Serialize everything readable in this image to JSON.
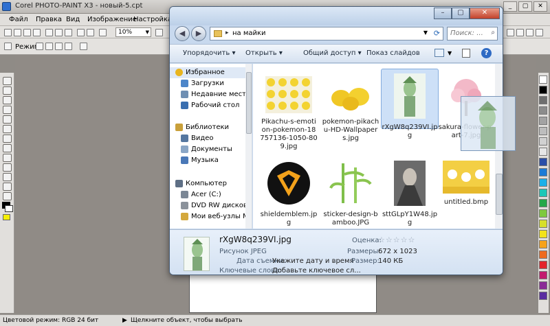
{
  "app": {
    "title": "Corel PHOTO-PAINT X3 - новый-5.cpt",
    "menu": [
      "Файл",
      "Правка",
      "Вид",
      "Изображение",
      "Настройка"
    ],
    "zoom": "10%",
    "mode_label": "Режим",
    "status_mode": "Цветовой режим: RGB 24 бит",
    "status_hint": "Щелкните объект, чтобы выбрать"
  },
  "explorer": {
    "address": "на майки",
    "search_placeholder": "Поиск: ...",
    "commands": {
      "organize": "Упорядочить ▾",
      "open": "Открыть ▾",
      "share": "Общий доступ ▾",
      "slideshow": "Показ слайдов"
    },
    "nav": [
      {
        "label": "Избранное",
        "icon": "star-icon",
        "section": true,
        "selected": true
      },
      {
        "label": "Загрузки",
        "icon": "downloads-icon"
      },
      {
        "label": "Недавние места",
        "icon": "recent-places-icon"
      },
      {
        "label": "Рабочий стол",
        "icon": "desktop-icon"
      },
      {
        "label": "Библиотеки",
        "icon": "libraries-icon",
        "section": true
      },
      {
        "label": "Видео",
        "icon": "video-icon"
      },
      {
        "label": "Документы",
        "icon": "documents-icon"
      },
      {
        "label": "Музыка",
        "icon": "music-icon"
      },
      {
        "label": "Компьютер",
        "icon": "computer-icon",
        "section": true
      },
      {
        "label": "Acer (C:)",
        "icon": "drive-icon"
      },
      {
        "label": "DVD RW дисков",
        "icon": "dvd-icon"
      },
      {
        "label": "Мои веб-узлы M",
        "icon": "web-folder-icon"
      }
    ],
    "files": [
      {
        "name": "Pikachu-s-emotion-pokemon-18757136-1050-809.jpg",
        "thumb": "pikachu-grid"
      },
      {
        "name": "pokemon-pikachu-HD-Wallpapers.jpg",
        "thumb": "pikachu-group"
      },
      {
        "name": "rXgW8q239VI.jpg",
        "thumb": "green-figure",
        "selected": true
      },
      {
        "name": "sakura-flower-p-art-7.jpg",
        "thumb": "sakura-tree"
      },
      {
        "name": "shieldemblem.jpg",
        "thumb": "shield-emblem"
      },
      {
        "name": "sticker-design-bamboo.JPG",
        "thumb": "bamboo"
      },
      {
        "name": "sttGLpY1W48.jpg",
        "thumb": "dark-figure"
      },
      {
        "name": "untitled.bmp",
        "thumb": "cartoon-cats"
      }
    ],
    "details": {
      "filename": "rXgW8q239VI.jpg",
      "type": "Рисунок JPEG",
      "date_label": "Дата съемки:",
      "date_value": "Укажите дату и время",
      "keywords_label": "Ключевые слова:",
      "keywords_value": "Добавьте ключевое сл...",
      "rating_label": "Оценка:",
      "rating": "☆☆☆☆☆",
      "dimensions_label": "Размеры:",
      "dimensions_value": "672 x 1023",
      "size_label": "Размер:",
      "size_value": "140 КБ"
    }
  },
  "colors": {
    "accent": "#2f6bc4",
    "selection": "#cde0f7",
    "workspace": "#908b86"
  }
}
